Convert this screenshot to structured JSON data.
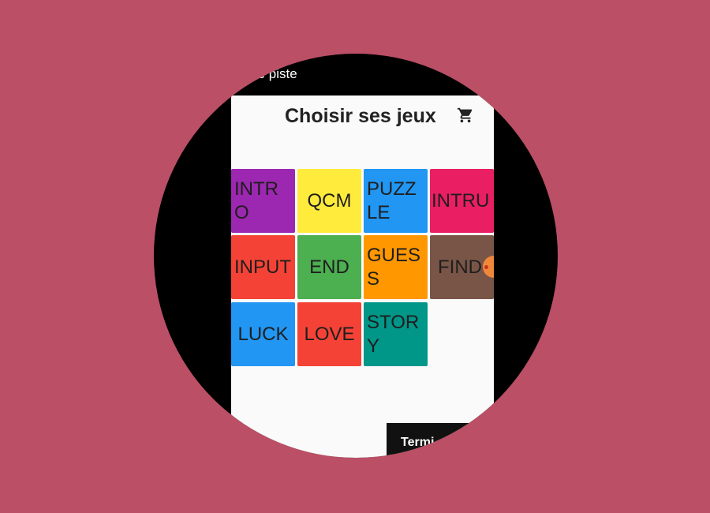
{
  "topbar": {
    "text": "u de piste"
  },
  "header": {
    "title": "Choisir ses jeux",
    "cart_icon": "cart-icon"
  },
  "tiles": [
    {
      "label": "INTRO",
      "color": "#9c27b0"
    },
    {
      "label": "QCM",
      "color": "#ffeb3b"
    },
    {
      "label": "PUZZLE",
      "color": "#2196f3"
    },
    {
      "label": "INTRU",
      "color": "#e91e63"
    },
    {
      "label": "INPUT",
      "color": "#f44336"
    },
    {
      "label": "END",
      "color": "#4caf50"
    },
    {
      "label": "GUESS",
      "color": "#ff9800"
    },
    {
      "label": "FIND",
      "color": "#795548"
    },
    {
      "label": "LUCK",
      "color": "#2196f3"
    },
    {
      "label": "LOVE",
      "color": "#f44336"
    },
    {
      "label": "STORY",
      "color": "#009688"
    }
  ],
  "footer": {
    "done_label": "Termi"
  },
  "colors": {
    "background": "#bb4f65",
    "frame": "#000000",
    "screen": "#fafafa"
  }
}
